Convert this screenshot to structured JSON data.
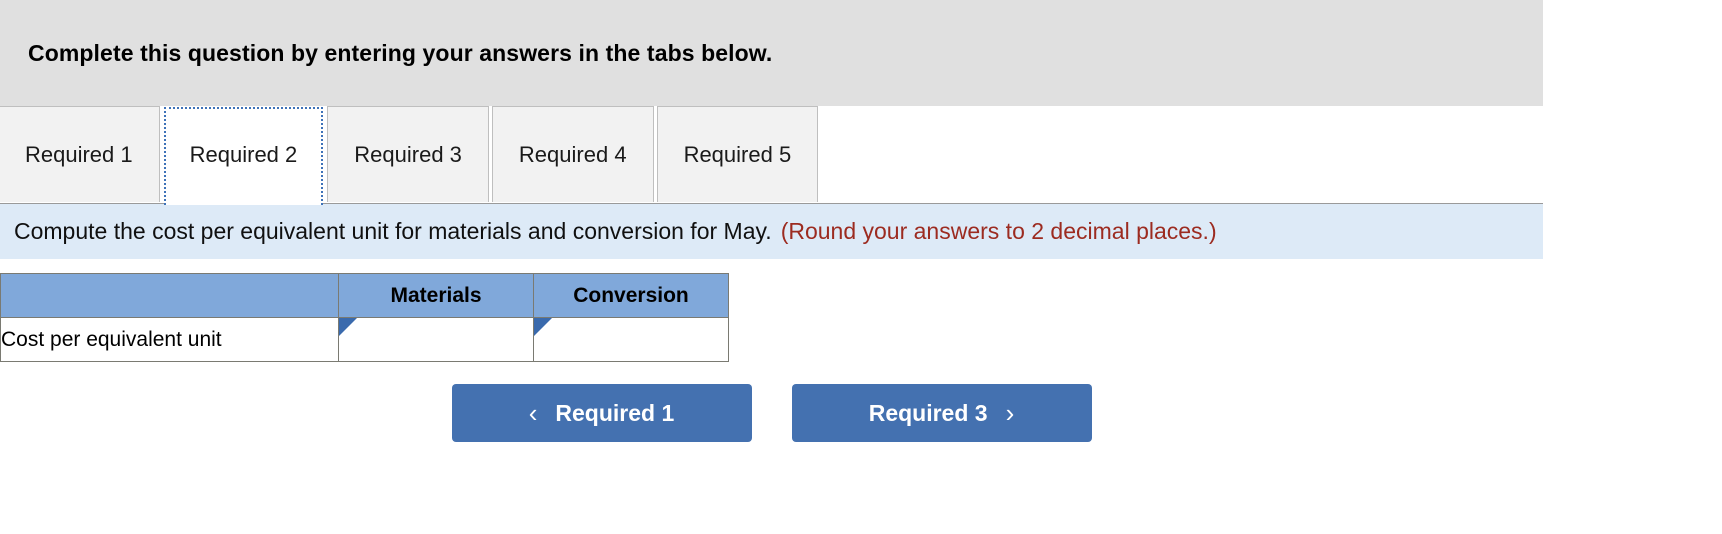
{
  "banner": {
    "text": "Complete this question by entering your answers in the tabs below."
  },
  "tabs": {
    "items": [
      {
        "label": "Required 1",
        "active": false
      },
      {
        "label": "Required 2",
        "active": true
      },
      {
        "label": "Required 3",
        "active": false
      },
      {
        "label": "Required 4",
        "active": false
      },
      {
        "label": "Required 5",
        "active": false
      }
    ]
  },
  "instruction": {
    "text": "Compute the cost per equivalent unit for materials and conversion for May.",
    "hint": "(Round your answers to 2 decimal places.)"
  },
  "table": {
    "headers": [
      "",
      "Materials",
      "Conversion"
    ],
    "rows": [
      {
        "label": "Cost per equivalent unit",
        "materials": "",
        "conversion": "",
        "materials_placeholder": "",
        "conversion_placeholder": ""
      }
    ]
  },
  "nav": {
    "prev_label": "Required 1",
    "prev_icon": "chevron-left-icon",
    "prev_chevron": "‹",
    "next_label": "Required 3",
    "next_icon": "chevron-right-icon",
    "next_chevron": "›"
  },
  "colors": {
    "banner_bg": "#e0e0e0",
    "instruction_bg": "#ddeaf7",
    "hint_text": "#9c2b20",
    "table_header_bg": "#80a8da",
    "button_bg": "#4471b0",
    "focus_ring": "#3e72b8",
    "input_border": "#4a6f9e",
    "marker": "#3a6aad"
  }
}
